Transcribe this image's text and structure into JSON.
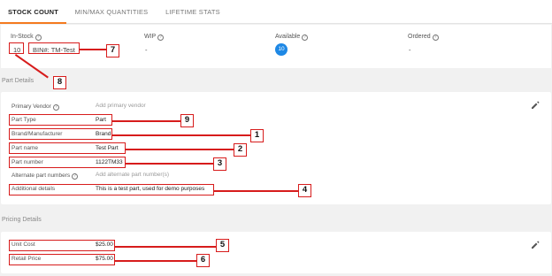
{
  "tabs": [
    "STOCK COUNT",
    "MIN/MAX QUANTITIES",
    "LIFETIME STATS"
  ],
  "stock": {
    "in_stock_label": "In-Stock",
    "in_stock_value": "10",
    "bin_text": "BIN#: TM-Test",
    "wip_label": "WIP",
    "wip_value": "-",
    "available_label": "Available",
    "available_value": "10",
    "ordered_label": "Ordered",
    "ordered_value": "-"
  },
  "part_details": {
    "section_title": "Part Details",
    "primary_vendor_label": "Primary Vendor",
    "primary_vendor_value": "Add primary vendor",
    "part_type_label": "Part Type",
    "part_type_value": "Part",
    "brand_label": "Brand/Manufacturer",
    "brand_value": "Brand",
    "part_name_label": "Part name",
    "part_name_value": "Test Part",
    "part_number_label": "Part number",
    "part_number_value": "1122TM33",
    "alt_numbers_label": "Alternate part numbers",
    "alt_numbers_value": "Add alternate part number(s)",
    "additional_label": "Additional details",
    "additional_value": "This is a test part, used for demo purposes"
  },
  "pricing": {
    "section_title": "Pricing Details",
    "unit_cost_label": "Unit Cost",
    "unit_cost_value": "$25.00",
    "retail_label": "Retail Price",
    "retail_value": "$75.00"
  },
  "callouts": [
    "1",
    "2",
    "3",
    "4",
    "5",
    "6",
    "7",
    "8",
    "9"
  ],
  "colors": {
    "accent": "#f47a20",
    "badge": "#1e88e5",
    "callout": "#d71c1c"
  },
  "icons": [
    "help-icon",
    "edit-icon"
  ]
}
